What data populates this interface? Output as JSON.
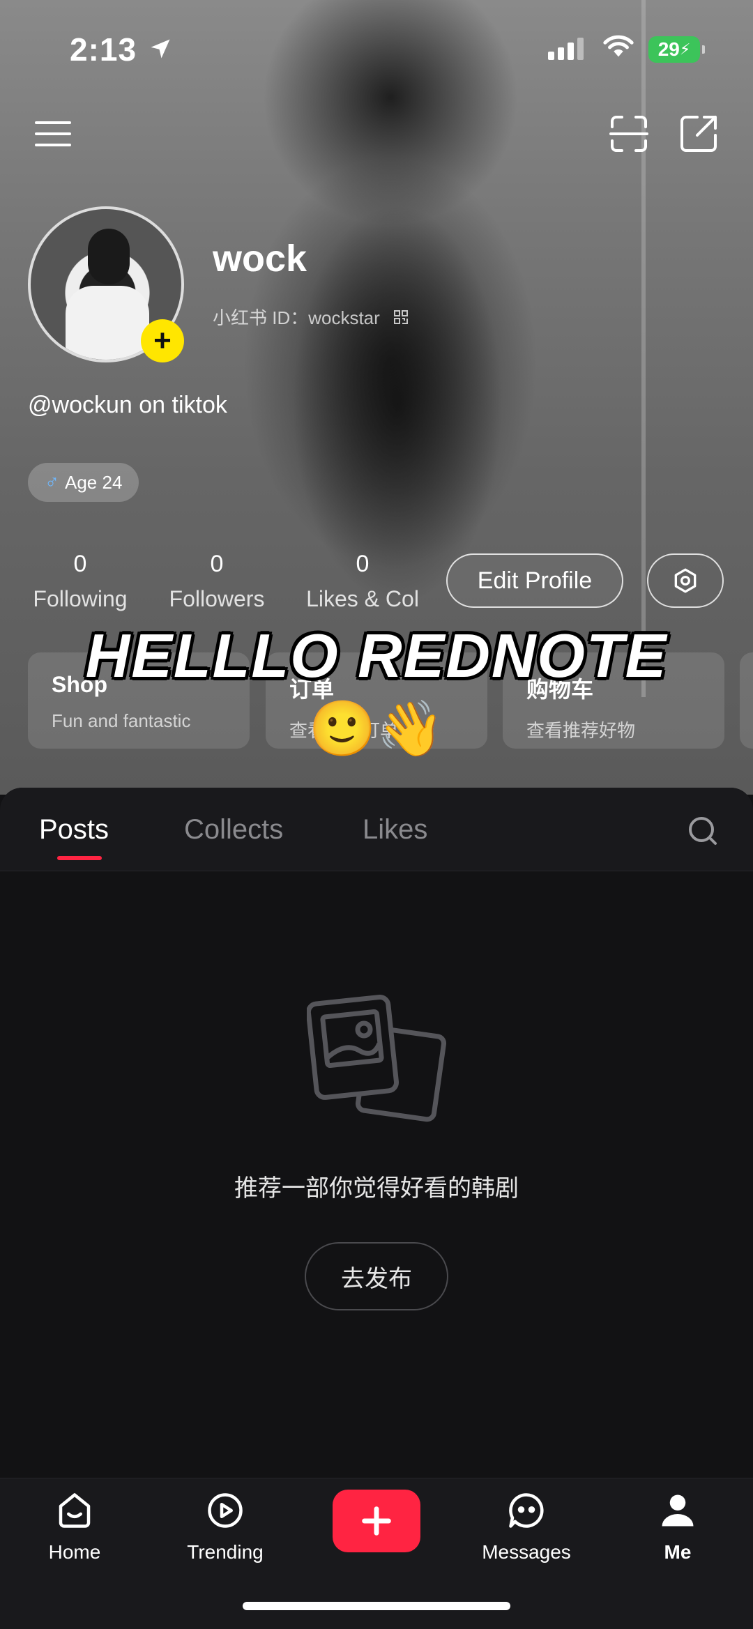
{
  "status_bar": {
    "time": "2:13",
    "battery": "29"
  },
  "profile": {
    "username": "wock",
    "id_label": "小红书 ID：wockstar",
    "bio": "@wockun on tiktok",
    "age_tag": "Age 24",
    "gender_symbol": "♂"
  },
  "stats": [
    {
      "num": "0",
      "label": "Following"
    },
    {
      "num": "0",
      "label": "Followers"
    },
    {
      "num": "0",
      "label": "Likes & Col"
    }
  ],
  "buttons": {
    "edit_profile": "Edit Profile"
  },
  "cards": [
    {
      "title": "Shop",
      "subtitle": "Fun and fantastic"
    },
    {
      "title": "订单",
      "subtitle": "查看我的订单"
    },
    {
      "title": "购物车",
      "subtitle": "查看推荐好物"
    }
  ],
  "overlay": {
    "text": "HELLLO  REDNOTE",
    "emoji": "🙂👋"
  },
  "tabs": [
    "Posts",
    "Collects",
    "Likes"
  ],
  "empty_state": {
    "message": "推荐一部你觉得好看的韩剧",
    "button": "去发布"
  },
  "nav": {
    "home": "Home",
    "trending": "Trending",
    "messages": "Messages",
    "me": "Me"
  },
  "colors": {
    "accent": "#ff2442",
    "badge_yellow": "#ffe600",
    "battery_green": "#3cc45a"
  }
}
